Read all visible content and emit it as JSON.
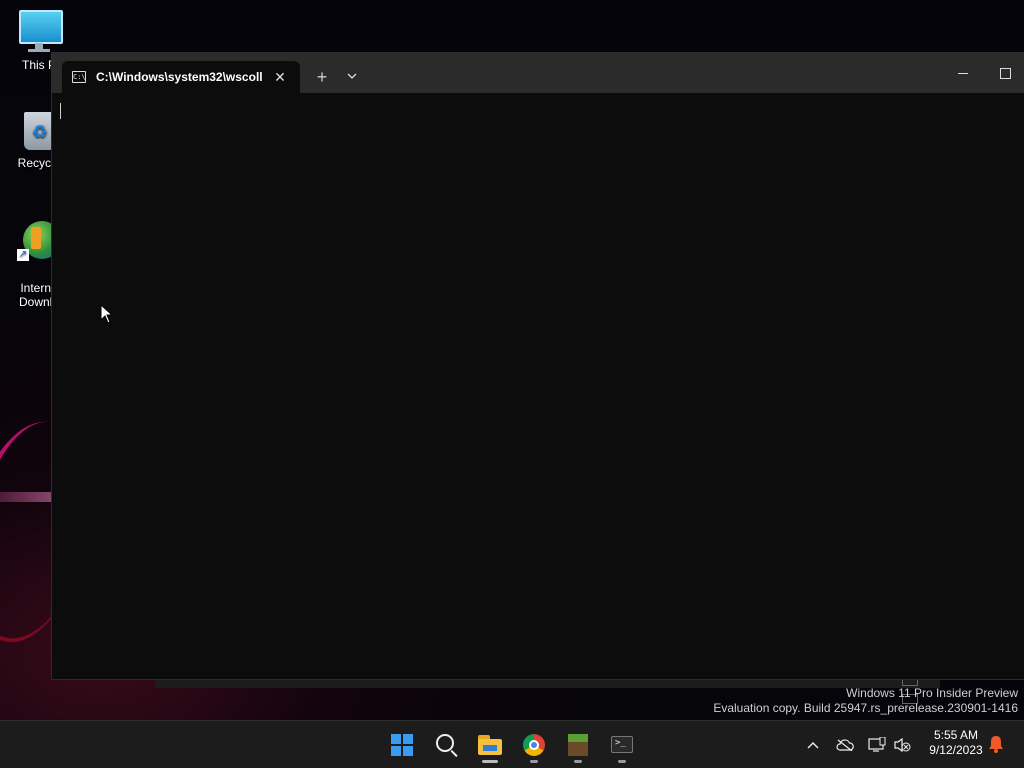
{
  "desktop": {
    "icons": [
      {
        "label": "This P"
      },
      {
        "label": "Recycle"
      },
      {
        "label": "Interne\nDownlo"
      }
    ]
  },
  "terminal": {
    "tab_title": "C:\\Windows\\system32\\wscoll",
    "console_text": ""
  },
  "watermark": {
    "line1": "Windows 11 Pro Insider Preview",
    "line2": "Evaluation copy. Build 25947.rs_prerelease.230901-1416"
  },
  "taskbar": {
    "apps": [
      "start-icon",
      "search-icon",
      "file-explorer-icon",
      "chrome-icon",
      "minecraft-icon",
      "terminal-icon"
    ],
    "time": "5:55 AM",
    "date": "9/12/2023"
  },
  "colors": {
    "accent": "#3a9cf0",
    "notification": "#f05a28"
  }
}
